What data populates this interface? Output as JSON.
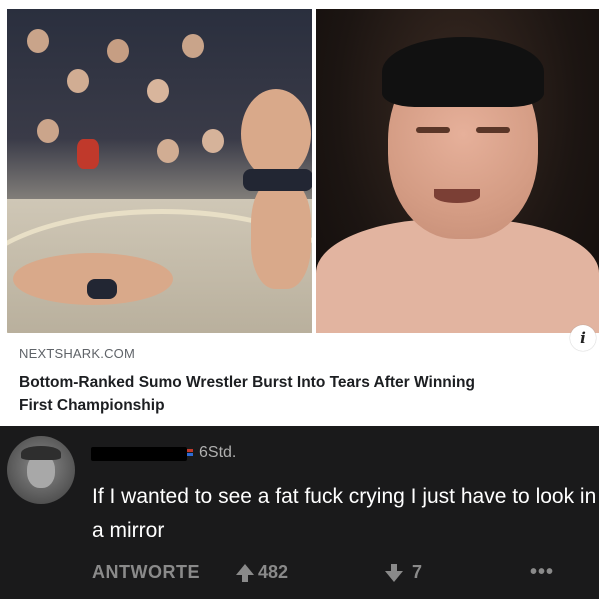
{
  "news_card": {
    "source": "NEXTSHARK.COM",
    "headline": "Bottom-Ranked Sumo Wrestler Burst Into Tears After Winning\nFirst Championship",
    "info_icon": "info-icon",
    "info_glyph": "i"
  },
  "comment": {
    "timestamp": "6Std.",
    "text": "If I wanted to see a fat fuck crying I just have to look in a mirror",
    "actions": {
      "reply_label": "ANTWORTE",
      "upvote_icon": "arrow-up-icon",
      "upvotes": "482",
      "downvote_icon": "arrow-down-icon",
      "downvotes": "7",
      "more_icon": "more-options-icon",
      "more_glyph": "•••"
    }
  },
  "colors": {
    "comment_background": "#1a1a1b",
    "comment_text": "#ffffff",
    "muted_text": "#8a8a8a",
    "card_background": "#ffffff"
  }
}
